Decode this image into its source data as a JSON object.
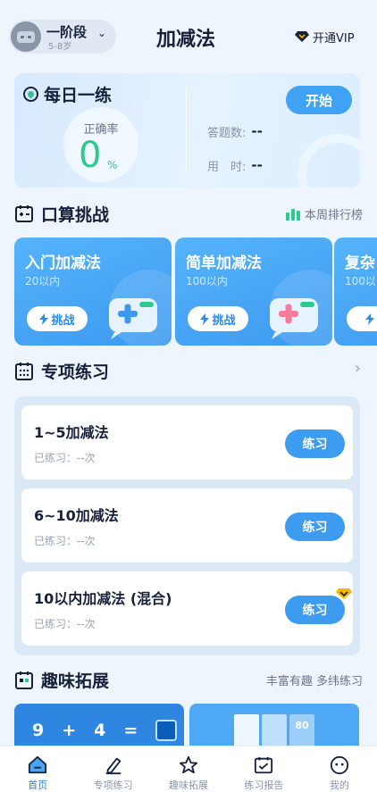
{
  "header": {
    "stage_name": "一阶段",
    "stage_age": "5-8岁",
    "title": "加减法",
    "vip_label": "开通VIP"
  },
  "daily": {
    "title": "每日一练",
    "accuracy_label": "正确率",
    "accuracy_value": "0",
    "accuracy_unit": "%",
    "answered_label": "答题数:",
    "answered_value": "--",
    "time_label": "用　时:",
    "time_value": "--",
    "start_label": "开始"
  },
  "challenge": {
    "title": "口算挑战",
    "ranking_label": "本周排行榜",
    "cards": [
      {
        "title": "入门加减法",
        "sub": "20以内",
        "button": "挑战"
      },
      {
        "title": "简单加减法",
        "sub": "100以内",
        "button": "挑战"
      },
      {
        "title": "复杂",
        "sub": "100以",
        "button": "挑"
      }
    ]
  },
  "special": {
    "title": "专项练习",
    "items": [
      {
        "title": "1~5加减法",
        "meta": "已练习：--次",
        "button": "练习"
      },
      {
        "title": "6~10加减法",
        "meta": "已练习：--次",
        "button": "练习"
      },
      {
        "title": "10以内加减法 (混合)",
        "meta": "已练习：--次",
        "button": "练习"
      }
    ]
  },
  "fun": {
    "title": "趣味拓展",
    "subtitle": "丰富有趣 多纬练习",
    "eq_a": "9",
    "eq_op1": "+",
    "eq_b": "4",
    "eq_op2": "=",
    "tag": "80"
  },
  "tabs": [
    {
      "label": "首页"
    },
    {
      "label": "专项练习"
    },
    {
      "label": "趣味拓展"
    },
    {
      "label": "练习报告"
    },
    {
      "label": "我的"
    }
  ],
  "colors": {
    "accent": "#3d9bf0",
    "success": "#2ec98c",
    "vip_gold": "#f5b400"
  }
}
